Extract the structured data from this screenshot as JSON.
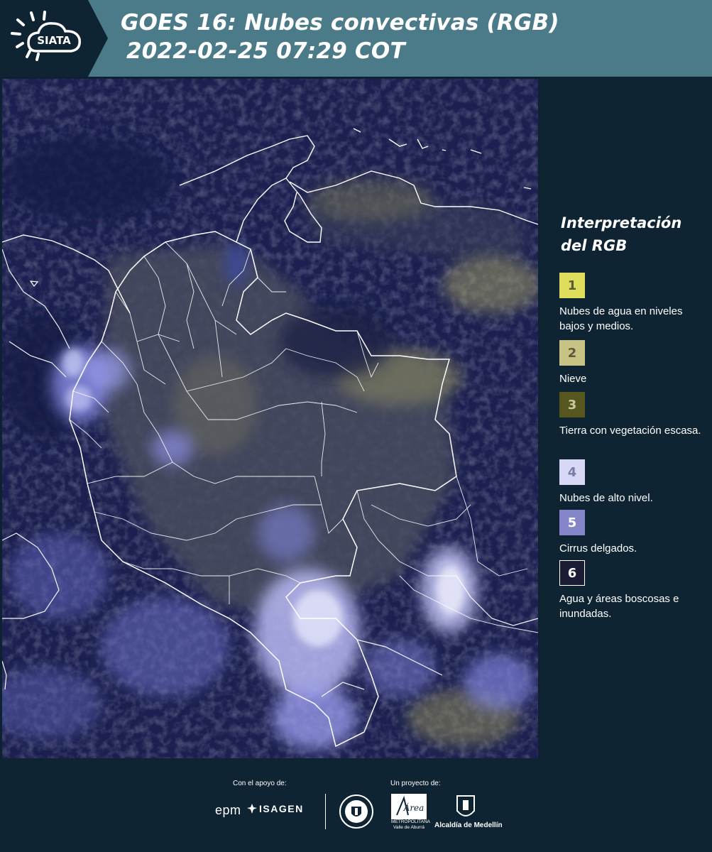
{
  "header": {
    "logo_text": "SIATA",
    "title_line1": "GOES 16: Nubes convectivas (RGB)",
    "title_line2": "2022-02-25 07:29 COT",
    "background": "#4b7a89"
  },
  "legend": {
    "title": "Interpretación del RGB",
    "items": [
      {
        "number": "1",
        "label": "Nubes de agua en niveles bajos y medios.",
        "color": "#dede5c"
      },
      {
        "number": "2",
        "label": "Nieve",
        "color": "#c7c483"
      },
      {
        "number": "3",
        "label": "Tierra con vegetación escasa.",
        "color": "#56571e"
      },
      {
        "number": "4",
        "label": "Nubes de alto nivel.",
        "color": "#d6d8f6"
      },
      {
        "number": "5",
        "label": "Cirrus delgados.",
        "color": "#8486c9"
      },
      {
        "number": "6",
        "label": "Agua y áreas boscosas e inundadas.",
        "color": "#1c1b35"
      }
    ]
  },
  "footer": {
    "support_caption": "Con el apoyo de:",
    "project_caption": "Un proyecto de:",
    "sponsor1": "epm",
    "sponsor2": "ISAGEN",
    "partner1_name": "Área",
    "partner1_subtitle": "METROPOLITANA Valle de Aburrá",
    "partner2": "Alcaldía de Medellín"
  },
  "map": {
    "icon": "satellite-map",
    "water_color": "#1a1f4a",
    "border_color": "#ffffff"
  }
}
